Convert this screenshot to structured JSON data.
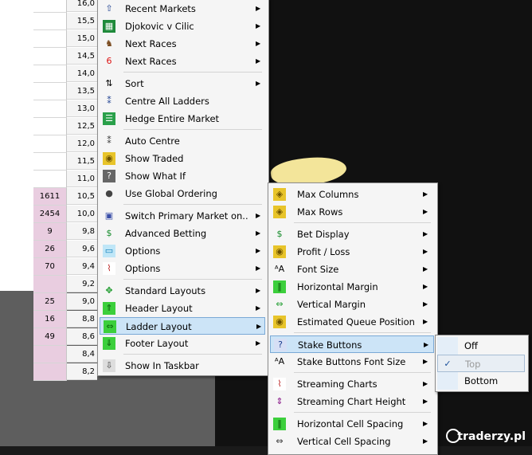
{
  "ladder": [
    {
      "vol": "",
      "price": "16,0",
      "pink": false
    },
    {
      "vol": "",
      "price": "15,5",
      "pink": false
    },
    {
      "vol": "",
      "price": "15,0",
      "pink": false
    },
    {
      "vol": "",
      "price": "14,5",
      "pink": false
    },
    {
      "vol": "",
      "price": "14,0",
      "pink": false
    },
    {
      "vol": "",
      "price": "13,5",
      "pink": false
    },
    {
      "vol": "",
      "price": "13,0",
      "pink": false
    },
    {
      "vol": "",
      "price": "12,5",
      "pink": false
    },
    {
      "vol": "",
      "price": "12,0",
      "pink": false
    },
    {
      "vol": "",
      "price": "11,5",
      "pink": false
    },
    {
      "vol": "",
      "price": "11,0",
      "pink": false
    },
    {
      "vol": "1611",
      "price": "10,5",
      "pink": true
    },
    {
      "vol": "2454",
      "price": "10,0",
      "pink": true
    },
    {
      "vol": "9",
      "price": "9,8",
      "pink": true
    },
    {
      "vol": "26",
      "price": "9,6",
      "pink": true
    },
    {
      "vol": "70",
      "price": "9,4",
      "pink": true
    },
    {
      "vol": "",
      "price": "9,2",
      "pink": true
    },
    {
      "vol": "25",
      "price": "9,0",
      "pink": true
    },
    {
      "vol": "16",
      "price": "8,8",
      "pink": true
    },
    {
      "vol": "49",
      "price": "8,6",
      "pink": true
    },
    {
      "vol": "",
      "price": "8,4",
      "pink": true
    },
    {
      "vol": "",
      "price": "8,2",
      "pink": true
    }
  ],
  "menu1": {
    "items": [
      {
        "label": "Recent Markets",
        "icon": "up-arrow-icon",
        "arrow": true
      },
      {
        "label": "Djokovic v Cilic",
        "icon": "tennis-court-icon",
        "arrow": true
      },
      {
        "label": "Next Races",
        "icon": "horse-icon",
        "arrow": true
      },
      {
        "label": "Next Races",
        "icon": "race-six-icon",
        "arrow": true
      },
      {
        "label": "Sort",
        "icon": "sort-az-icon",
        "arrow": true
      },
      {
        "label": "Centre All Ladders",
        "icon": "centre-ladders-icon",
        "arrow": false
      },
      {
        "label": "Hedge Entire Market",
        "icon": "hedge-icon",
        "arrow": false
      },
      {
        "label": "Auto Centre",
        "icon": "auto-centre-icon",
        "arrow": false
      },
      {
        "label": "Show Traded",
        "icon": "coins-icon",
        "arrow": false
      },
      {
        "label": "Show What If",
        "icon": "question-icon",
        "arrow": false
      },
      {
        "label": "Use Global Ordering",
        "icon": "globe-icon",
        "arrow": false
      },
      {
        "label": "Switch Primary Market on..",
        "icon": "switch-market-icon",
        "arrow": true
      },
      {
        "label": "Advanced Betting",
        "icon": "dollar-icon",
        "arrow": true
      },
      {
        "label": "Options",
        "icon": "monitor-icon",
        "arrow": true
      },
      {
        "label": "Options",
        "icon": "chart-icon",
        "arrow": true
      },
      {
        "label": "Standard Layouts",
        "icon": "four-arrows-icon",
        "arrow": true
      },
      {
        "label": "Header Layout",
        "icon": "header-layout-icon",
        "arrow": true
      },
      {
        "label": "Ladder Layout",
        "icon": "horizontal-arrows-icon",
        "arrow": true
      },
      {
        "label": "Footer Layout",
        "icon": "footer-layout-icon",
        "arrow": true
      },
      {
        "label": "Show In Taskbar",
        "icon": "taskbar-download-icon",
        "arrow": false
      }
    ]
  },
  "menu2": {
    "items": [
      {
        "label": "Max Columns",
        "icon": "diamond-columns-icon",
        "arrow": true
      },
      {
        "label": "Max Rows",
        "icon": "diamond-rows-icon",
        "arrow": true
      },
      {
        "label": "Bet Display",
        "icon": "dollar-icon",
        "arrow": true
      },
      {
        "label": "Profit / Loss",
        "icon": "coins-icon",
        "arrow": true
      },
      {
        "label": "Font Size",
        "icon": "font-size-icon",
        "arrow": true
      },
      {
        "label": "Horizontal Margin",
        "icon": "horizontal-margin-icon",
        "arrow": true
      },
      {
        "label": "Vertical Margin",
        "icon": "vertical-margin-icon",
        "arrow": true
      },
      {
        "label": "Estimated Queue Position",
        "icon": "queue-coins-icon",
        "arrow": true
      },
      {
        "label": "Stake Buttons",
        "icon": "question-box-icon",
        "arrow": true
      },
      {
        "label": "Stake Buttons Font Size",
        "icon": "font-size-icon",
        "arrow": true
      },
      {
        "label": "Streaming Charts",
        "icon": "chart-icon",
        "arrow": true
      },
      {
        "label": "Streaming Chart Height",
        "icon": "up-down-arrow-icon",
        "arrow": true
      },
      {
        "label": "Horizontal Cell Spacing",
        "icon": "horizontal-spacing-icon",
        "arrow": true
      },
      {
        "label": "Vertical Cell Spacing",
        "icon": "vertical-spacing-icon",
        "arrow": true
      }
    ]
  },
  "menu3": {
    "items": [
      {
        "label": "Off",
        "checked": false,
        "disabled": false
      },
      {
        "label": "Top",
        "checked": true,
        "disabled": true
      },
      {
        "label": "Bottom",
        "checked": false,
        "disabled": false
      }
    ]
  },
  "watermark": "traderzy.pl",
  "colors": {
    "highlight": "#cce4f7",
    "pink": "#e9cde0",
    "menu_bg": "#f5f5f5"
  }
}
